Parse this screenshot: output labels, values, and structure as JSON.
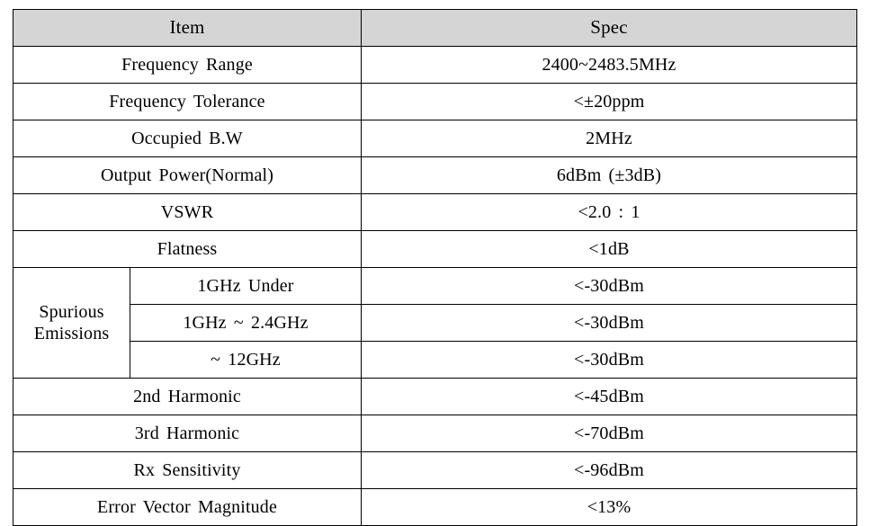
{
  "table": {
    "headers": {
      "item": "Item",
      "spec": "Spec"
    },
    "group_labels": {
      "spurious_emissions": "Spurious\nEmissions"
    },
    "rows": [
      {
        "item": "Frequency Range",
        "spec": "2400~2483.5MHz"
      },
      {
        "item": "Frequency Tolerance",
        "spec": "<±20ppm"
      },
      {
        "item": "Occupied B.W",
        "spec": "2MHz"
      },
      {
        "item": "Output Power(Normal)",
        "spec": "6dBm (±3dB)"
      },
      {
        "item": "VSWR",
        "spec": "<2.0 : 1"
      },
      {
        "item": "Flatness",
        "spec": "<1dB"
      },
      {
        "item": "1GHz Under",
        "spec": "<-30dBm",
        "group": "Spurious Emissions"
      },
      {
        "item": "1GHz ~ 2.4GHz",
        "spec": "<-30dBm",
        "group": "Spurious Emissions"
      },
      {
        "item": "~ 12GHz",
        "spec": "<-30dBm",
        "group": "Spurious Emissions"
      },
      {
        "item": "2nd Harmonic",
        "spec": "<-45dBm"
      },
      {
        "item": "3rd Harmonic",
        "spec": "<-70dBm"
      },
      {
        "item": "Rx Sensitivity",
        "spec": "<-96dBm"
      },
      {
        "item": "Error Vector Magnitude",
        "spec": "<13%"
      }
    ],
    "colors": {
      "header_background": "#d5d5d5",
      "border": "#000000",
      "cell_background": "#ffffff",
      "text": "#000000"
    }
  }
}
